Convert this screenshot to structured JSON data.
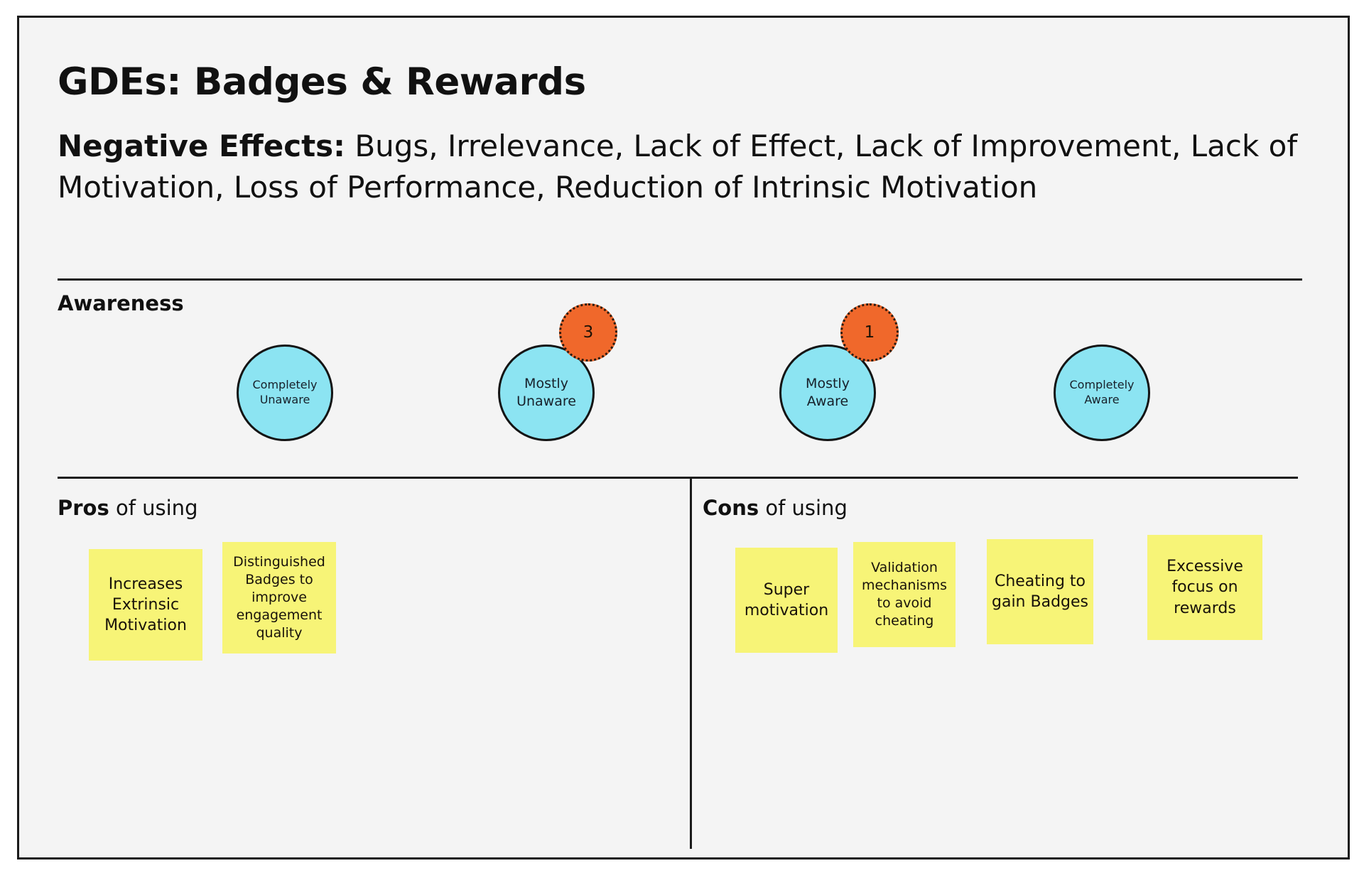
{
  "board": {
    "title": "GDEs: Badges & Rewards",
    "subtitle_lead": "Negative Effects:",
    "subtitle_body": " Bugs, Irrelevance, Lack of Effect, Lack of Improvement, Lack of Motivation, Loss of Performance, Reduction of Intrinsic Motivation"
  },
  "awareness": {
    "label": "Awareness",
    "items": [
      {
        "label": "Completely\nUnaware",
        "count": ""
      },
      {
        "label": "Mostly\nUnaware",
        "count": "3"
      },
      {
        "label": "Mostly\nAware",
        "count": "1"
      },
      {
        "label": "Completely\nAware",
        "count": ""
      }
    ]
  },
  "pros": {
    "label_strong": "Pros",
    "label_rest": " of using",
    "notes": [
      "Increases Extrinsic Motivation",
      "Distinguished Badges to improve engagement quality"
    ]
  },
  "cons": {
    "label_strong": "Cons",
    "label_rest": " of using",
    "notes": [
      "Super motivation",
      "Validation mechanisms to avoid cheating",
      "Cheating to gain Badges",
      "Excessive focus  on rewards"
    ]
  },
  "colors": {
    "canvas": "#f4f4f4",
    "frame_border": "#1b1b1b",
    "bubble_fill": "#8ce4f2",
    "badge_fill": "#f0682b",
    "note_fill": "#f7f477",
    "text": "#111111"
  }
}
